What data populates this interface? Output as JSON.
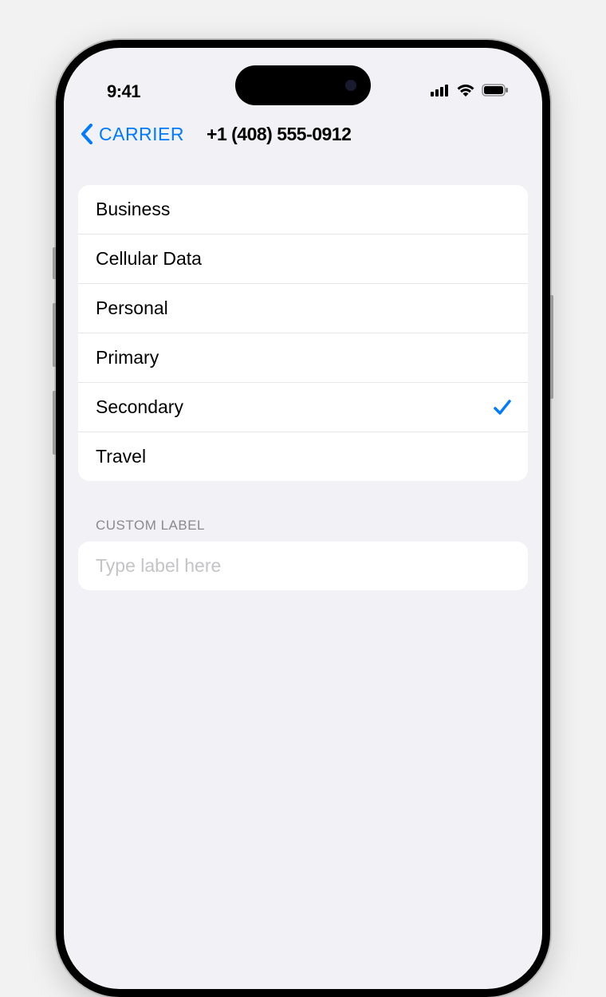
{
  "status": {
    "time": "9:41"
  },
  "nav": {
    "back_label": "CARRIER",
    "title": "+1 (408) 555-0912"
  },
  "labels": {
    "items": [
      {
        "text": "Business",
        "selected": false
      },
      {
        "text": "Cellular Data",
        "selected": false
      },
      {
        "text": "Personal",
        "selected": false
      },
      {
        "text": "Primary",
        "selected": false
      },
      {
        "text": "Secondary",
        "selected": true
      },
      {
        "text": "Travel",
        "selected": false
      }
    ]
  },
  "custom": {
    "header": "CUSTOM LABEL",
    "placeholder": "Type label here",
    "value": ""
  }
}
